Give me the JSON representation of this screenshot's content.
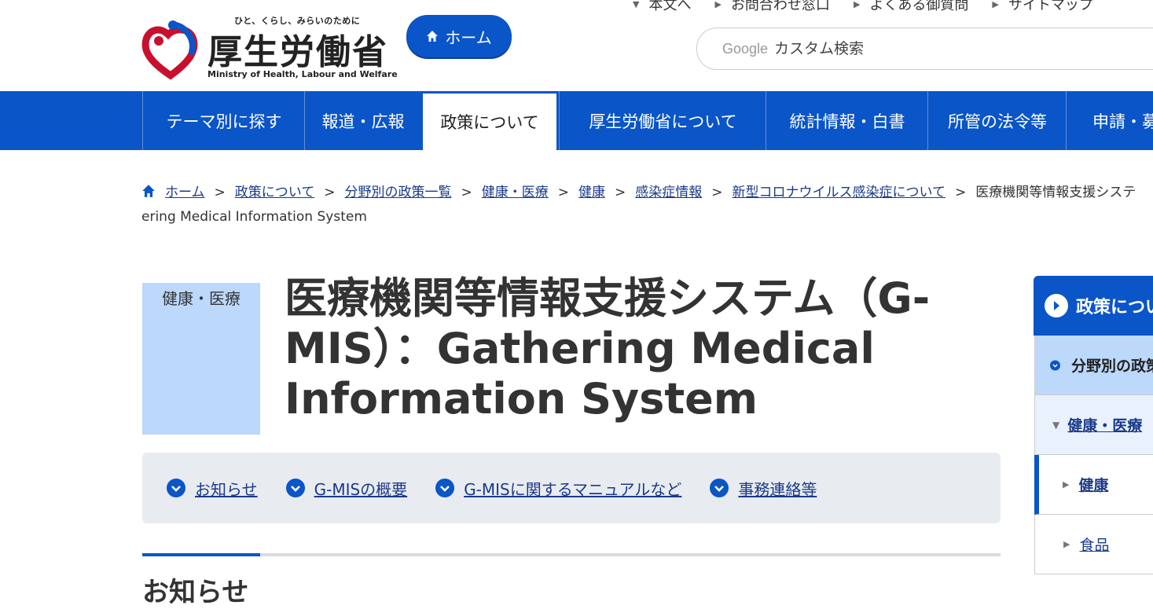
{
  "header": {
    "logo_tagline": "ひと、くらし、みらいのために",
    "logo_name": "厚生労働省",
    "logo_en": "Ministry of Health, Labour and Welfare",
    "home_button": "ホーム",
    "util_links": [
      "本文へ",
      "お問合わせ窓口",
      "よくある御質問",
      "サイトマップ"
    ],
    "search": {
      "brand": "Google",
      "placeholder": "カスタム検索"
    }
  },
  "gnav": {
    "items": [
      "テーマ別に探す",
      "報道・広報",
      "政策について",
      "厚生労働省について",
      "統計情報・白書",
      "所管の法令等",
      "申請・募"
    ],
    "active": "政策について"
  },
  "breadcrumb": {
    "items": [
      "ホーム",
      "政策について",
      "分野別の政策一覧",
      "健康・医療",
      "健康",
      "感染症情報",
      "新型コロナウイルス感染症について"
    ],
    "current_part1": "医療機関等情報支援システ",
    "current_part2": "ering Medical Information System"
  },
  "page": {
    "category": "健康・医療",
    "title": "医療機関等情報支援システム（G-MIS）：Gathering Medical Information System"
  },
  "anchors": [
    "お知らせ",
    "G-MISの概要",
    "G-MISに関するマニュアルなど",
    "事務連絡等"
  ],
  "section": {
    "heading": "お知らせ"
  },
  "side_menu": {
    "title": "政策について",
    "level1": "分野別の政策一覧",
    "level2": "健康・医療",
    "level3": "健康",
    "level4": "食品"
  },
  "colors": {
    "primary": "#0a55c8",
    "category_bg": "#bcd8fb",
    "anchor_bg": "#e8ebef",
    "link": "#1a3a8a"
  }
}
